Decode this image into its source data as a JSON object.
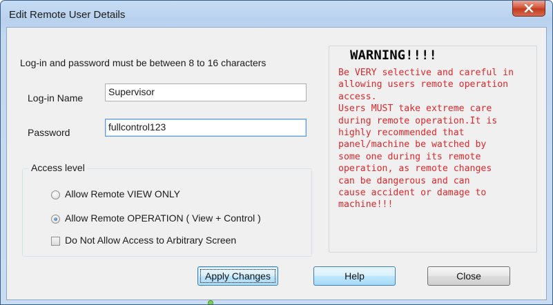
{
  "window": {
    "title": "Edit Remote User Details"
  },
  "form": {
    "hint": "Log-in and password must be between 8 to 16 characters",
    "login_label": "Log-in Name",
    "login_value": "Supervisor",
    "password_label": "Password",
    "password_value": "fullcontrol123"
  },
  "access": {
    "legend": "Access level",
    "options": [
      {
        "label": "Allow Remote VIEW ONLY",
        "selected": false
      },
      {
        "label": "Allow Remote OPERATION ( View + Control )",
        "selected": true
      }
    ],
    "checkbox_label": "Do Not Allow Access to Arbitrary Screen",
    "checkbox_checked": false
  },
  "warning": {
    "title": "WARNING!!!!",
    "text": "Be VERY selective and careful in\nallowing users remote operation\naccess.\nUsers MUST take extreme care\nduring remote operation.It is\nhighly recommended that\npanel/machine be watched by\nsome one during its remote\noperation, as remote changes\ncan be dangerous and can\ncause accident or damage to\nmachine!!!",
    "color": "#e2262a"
  },
  "buttons": {
    "apply": "Apply Changes",
    "help": "Help",
    "close": "Close"
  },
  "icons": {
    "close": "close-icon"
  }
}
